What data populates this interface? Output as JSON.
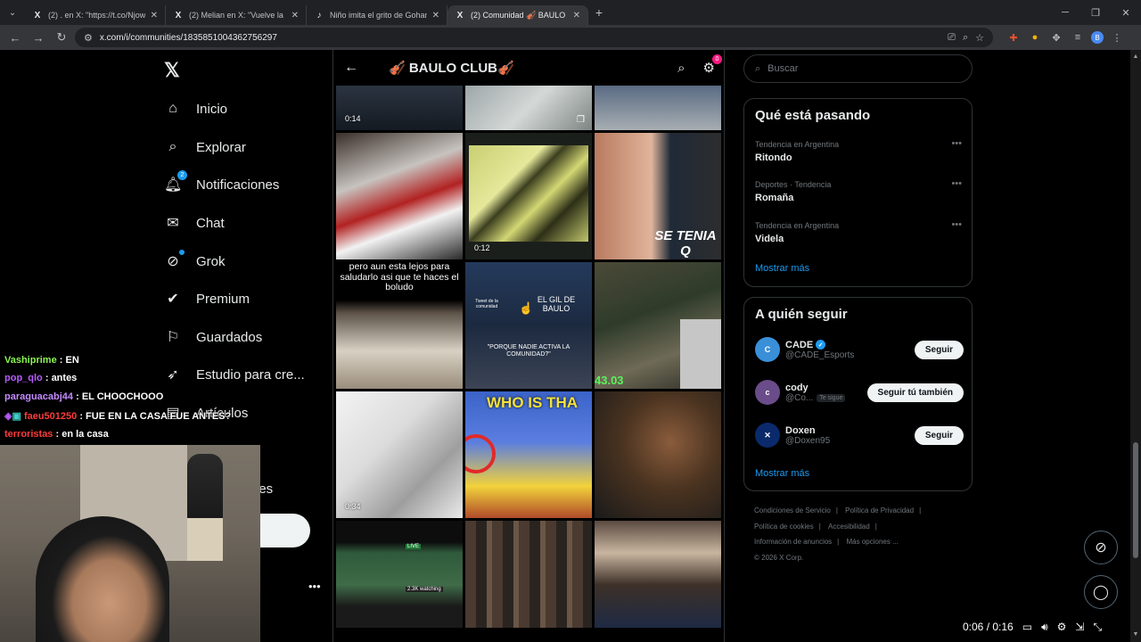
{
  "browser": {
    "tabs": [
      {
        "favicon": "X",
        "title": "(2) . en X: \"https://t.co/NjowkVj",
        "active": false
      },
      {
        "favicon": "X",
        "title": "(2) Melian en X: \"Vuelve la mej",
        "active": false
      },
      {
        "favicon": "♪",
        "title": "Niño imita el grito de Gohan e",
        "active": false
      },
      {
        "favicon": "X",
        "title": "(2) Comunidad 🎻 BAULO CLUB",
        "active": true
      }
    ],
    "url": "x.com/i/communities/1835851004362756297"
  },
  "nav": {
    "items": [
      {
        "label": "Inicio",
        "icon": "home-icon"
      },
      {
        "label": "Explorar",
        "icon": "search-icon"
      },
      {
        "label": "Notificaciones",
        "icon": "bell-icon",
        "badge": "2"
      },
      {
        "label": "Chat",
        "icon": "mail-icon"
      },
      {
        "label": "Grok",
        "icon": "grok-icon"
      },
      {
        "label": "Premium",
        "icon": "premium-icon"
      },
      {
        "label": "Guardados",
        "icon": "bookmark-icon"
      },
      {
        "label": "Estudio para cre...",
        "icon": "rocket-icon"
      },
      {
        "label": "Artículos",
        "icon": "article-icon"
      },
      {
        "label": "nes",
        "icon": ""
      }
    ]
  },
  "community": {
    "title": "🎻 BAULO CLUB🎻",
    "settings_badge": "0",
    "tiles": [
      {
        "duration": "0:14"
      },
      {
        "caption": "EL GIL DE BAULO"
      },
      {
        "duration": "0:12"
      },
      {
        "caption": "SE TENIA Q"
      },
      {
        "caption": "pero aun esta lejos para saludarlo asi que te haces el boludo"
      },
      {
        "caption": "\"PORQUE NADIE ACTIVA LA COMUNIDAD?\""
      },
      {
        "caption": "43.03"
      },
      {
        "duration": "0:34"
      },
      {
        "caption": "WHO IS THA"
      },
      {
        "caption": "Tweet de la comunidad"
      },
      {
        "caption": "2.3K watching"
      },
      {
        "caption": "LIVE"
      }
    ]
  },
  "right": {
    "search_placeholder": "Buscar",
    "trends_title": "Qué está pasando",
    "trends": [
      {
        "meta": "Tendencia en Argentina",
        "name": "Ritondo"
      },
      {
        "meta": "Deportes · Tendencia",
        "name": "Romaña"
      },
      {
        "meta": "Tendencia en Argentina",
        "name": "Videla"
      }
    ],
    "show_more": "Mostrar más",
    "follow_title": "A quién seguir",
    "follow": [
      {
        "name": "CADE",
        "handle": "@CADE_Esports",
        "button": "Seguir",
        "verified": true,
        "avatar_color": "#3a8fd9"
      },
      {
        "name": "cody",
        "handle": "@Co...",
        "tag": "Te sigue",
        "button": "Seguir tú también",
        "verified": false,
        "avatar_color": "#6b4c8a"
      },
      {
        "name": "Doxen",
        "handle": "@Doxen95",
        "button": "Seguir",
        "verified": false,
        "avatar_color": "#0a2a6b"
      }
    ],
    "footer": [
      "Condiciones de Servicio",
      "Política de Privacidad",
      "Política de cookies",
      "Accesibilidad",
      "Información de anuncios",
      "Más opciones ...",
      "© 2026 X Corp."
    ]
  },
  "chat": [
    {
      "user": "Vashiprime",
      "color": "#8bf554",
      "text": "EN"
    },
    {
      "user": "pop_qlo",
      "color": "#b85cff",
      "text": "antes"
    },
    {
      "user": "paraguacabj44",
      "color": "#c58cff",
      "text": "EL CHOOCHOOO"
    },
    {
      "user": "faeu501250",
      "color": "#ff3b3b",
      "text": "FUE EN LA CASA FUE ANTES?"
    },
    {
      "user": "terroristas",
      "color": "#ff3b3b",
      "text": "en la casa"
    }
  ],
  "video": {
    "time": "0:06 / 0:16"
  }
}
